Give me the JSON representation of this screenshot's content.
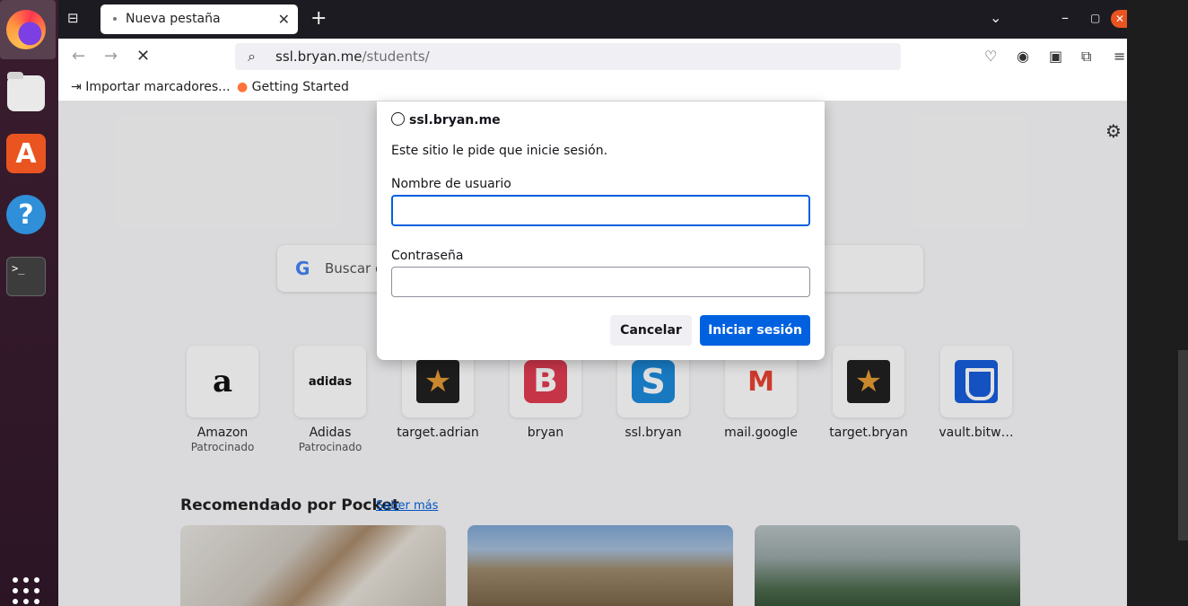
{
  "dock": {
    "items": [
      {
        "name": "firefox",
        "icon": "firefox-icon"
      },
      {
        "name": "files",
        "icon": "folder-icon"
      },
      {
        "name": "app-center",
        "icon": "store-icon"
      },
      {
        "name": "help",
        "icon": "help-icon",
        "glyph": "?"
      },
      {
        "name": "terminal",
        "icon": "terminal-icon",
        "glyph": ">_"
      }
    ],
    "apps_icon": "apps-grid-icon"
  },
  "tabs": [
    {
      "label": "Nueva pestaña",
      "active": true
    }
  ],
  "url": {
    "host": "ssl.bryan.me",
    "path": "/students/"
  },
  "bookmarks": [
    {
      "label": "Importar marcadores...",
      "icon": "import-icon"
    },
    {
      "label": "Getting Started",
      "icon": "firefox-icon"
    }
  ],
  "search": {
    "placeholder": "Buscar c"
  },
  "top_sites": [
    {
      "label": "Amazon",
      "sub": "Patrocinado",
      "icon": "amazon-icon"
    },
    {
      "label": "Adidas",
      "sub": "Patrocinado",
      "icon": "adidas-icon"
    },
    {
      "label": "target.adrian",
      "sub": "",
      "icon": "star-icon"
    },
    {
      "label": "bryan",
      "sub": "",
      "icon": "b-icon"
    },
    {
      "label": "ssl.bryan",
      "sub": "",
      "icon": "s-icon"
    },
    {
      "label": "mail.google",
      "sub": "",
      "icon": "gmail-icon"
    },
    {
      "label": "target.bryan",
      "sub": "",
      "icon": "star-icon"
    },
    {
      "label": "vault.bitw…",
      "sub": "",
      "icon": "bitwarden-icon"
    }
  ],
  "pocket": {
    "heading": "Recomendado por Pocket",
    "link": "Saber más"
  },
  "dialog": {
    "host": "ssl.bryan.me",
    "message": "Este sitio le pide que inicie sesión.",
    "username_label": "Nombre de usuario",
    "username_value": "",
    "password_label": "Contraseña",
    "password_value": "",
    "cancel_label": "Cancelar",
    "login_label": "Iniciar sesión"
  },
  "colors": {
    "accent": "#0061e0",
    "ubuntu_orange": "#e95420"
  }
}
